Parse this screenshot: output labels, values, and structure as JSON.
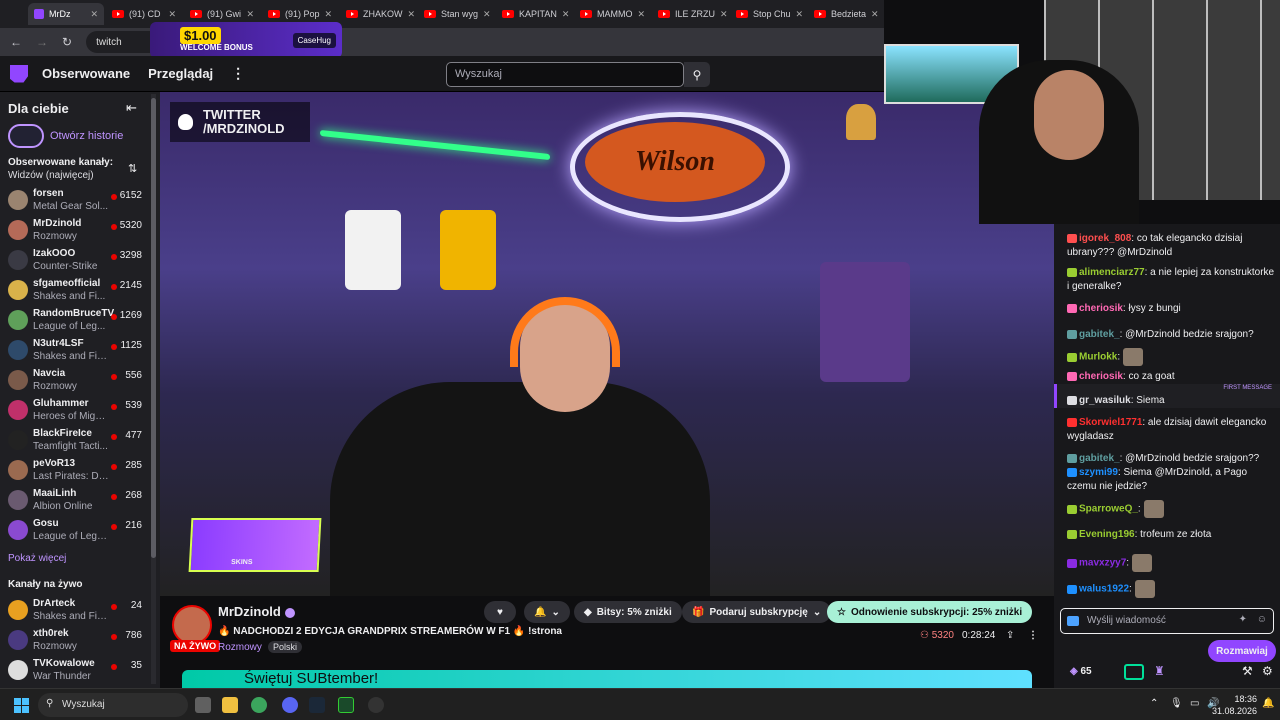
{
  "browser": {
    "tabs": [
      {
        "label": "MrDz",
        "kind": "twitch",
        "active": true
      },
      {
        "label": "(91) CD",
        "kind": "yt"
      },
      {
        "label": "(91) Gwi",
        "kind": "yt"
      },
      {
        "label": "(91) Pop",
        "kind": "yt"
      },
      {
        "label": "ZHAKOW",
        "kind": "yt"
      },
      {
        "label": "Stan wyg",
        "kind": "yt"
      },
      {
        "label": "KAPITAN",
        "kind": "yt"
      },
      {
        "label": "MAMMO",
        "kind": "yt"
      },
      {
        "label": "ILE ZRZU",
        "kind": "yt"
      },
      {
        "label": "Stop Chu",
        "kind": "yt"
      },
      {
        "label": "Bedzieta",
        "kind": "yt"
      }
    ],
    "url": "twitch",
    "ad": {
      "price": "$1.00",
      "text": "WELCOME BONUS",
      "brand": "CaseHug"
    }
  },
  "header": {
    "nav_following": "Obserwowane",
    "nav_browse": "Przeglądaj",
    "search_placeholder": "Wyszukaj"
  },
  "sidebar": {
    "title": "Dla ciebie",
    "history": "Otwórz historie",
    "followed_title": "Obserwowane kanały:",
    "followed_sort": "Widzów (najwięcej)",
    "followed": [
      {
        "name": "forsen",
        "game": "Metal Gear Sol...",
        "viewers": "6152",
        "color": "#9a8470"
      },
      {
        "name": "MrDzinold",
        "game": "Rozmowy",
        "viewers": "5320",
        "color": "#b46a58"
      },
      {
        "name": "IzakOOO",
        "game": "Counter-Strike",
        "viewers": "3298",
        "color": "#3a3a44"
      },
      {
        "name": "sfgameofficial",
        "game": "Shakes and Fi...",
        "viewers": "2145",
        "color": "#d9b24a"
      },
      {
        "name": "RandomBruceTV",
        "game": "League of Leg...",
        "viewers": "1269",
        "color": "#5fa05a"
      },
      {
        "name": "N3utr4LSF",
        "game": "Shakes and Fid...",
        "viewers": "1125",
        "color": "#2e4a6a"
      },
      {
        "name": "Navcia",
        "game": "Rozmowy",
        "viewers": "556",
        "color": "#7a5a4a"
      },
      {
        "name": "Gluhammer",
        "game": "Heroes of Migh...",
        "viewers": "539",
        "color": "#c0306a"
      },
      {
        "name": "BlackFireIce",
        "game": "Teamfight Tacti...",
        "viewers": "477",
        "color": "#222"
      },
      {
        "name": "peVoR13",
        "game": "Last Pirates: Di...",
        "viewers": "285",
        "color": "#9a6a50"
      },
      {
        "name": "MaaiLinh",
        "game": "Albion Online",
        "viewers": "268",
        "color": "#6a5a70"
      },
      {
        "name": "Gosu",
        "game": "League of Lege...",
        "viewers": "216",
        "color": "#8a4ad0"
      }
    ],
    "show_more": "Pokaż więcej",
    "live_title": "Kanały na żywo",
    "live": [
      {
        "name": "DrArteck",
        "game": "Shakes and Fid...",
        "viewers": "24",
        "color": "#e8a020"
      },
      {
        "name": "xth0rek",
        "game": "Rozmowy",
        "viewers": "786",
        "color": "#4a3a80"
      },
      {
        "name": "TVKowalowe",
        "game": "War Thunder",
        "viewers": "35",
        "color": "#ddd"
      }
    ]
  },
  "video": {
    "badge": "TWITTER /MRDZINOLD",
    "ball_brand": "Wilson",
    "overlay_brand": "SKINS"
  },
  "stream": {
    "streamer": "MrDzinold",
    "live_badge": "NA ŻYWO",
    "title": "🔥 NADCHODZI 2 EDYCJA GRANDPRIX STREAMERÓW W F1 🔥 !strona",
    "category": "Rozmowy",
    "tag": "Polski",
    "bits": "Bitsy: 5% zniżki",
    "gift": "Podaruj subskrypcję",
    "renew": "Odnowienie subskrypcji: 25% zniżki",
    "viewers": "5320",
    "uptime": "0:28:24",
    "banner": "Świętuj SUBtember!"
  },
  "chat": {
    "messages": [
      {
        "user": "igorek_808",
        "color": "#ff4f4f",
        "text": ": co tak elegancko dzisiaj ubrany??? @MrDzinold"
      },
      {
        "user": "alimenciarz77",
        "color": "#9acd32",
        "text": ": a nie lepiej za konstruktorke i generalke?"
      },
      {
        "user": "cheriosik",
        "color": "#ff69b4",
        "text": ": łysy z bungi"
      },
      {
        "user": "gabitek_",
        "color": "#5f9ea0",
        "text": ": @MrDzinold bedzie srajgon?"
      },
      {
        "user": "Murlokk",
        "color": "#9acd32",
        "text": ":"
      },
      {
        "user": "cheriosik",
        "color": "#ff69b4",
        "text": ": co za goat"
      },
      {
        "user": "gr_wasiluk",
        "color": "#dedee3",
        "text": ": Siema"
      },
      {
        "user": "Skorwiel1771",
        "color": "#ff3030",
        "text": ": ale dzisiaj dawit elegancko wygladasz"
      },
      {
        "user": "gabitek_",
        "color": "#5f9ea0",
        "text": ": @MrDzinold bedzie srajgon??"
      },
      {
        "user": "szymi99",
        "color": "#1e90ff",
        "text": ": Siema @MrDzinold, a Pago czemu nie jedzie?"
      },
      {
        "user": "SparroweQ_",
        "color": "#9acd32",
        "text": ":"
      },
      {
        "user": "Evening196",
        "color": "#9acd32",
        "text": ": trofeum ze złota"
      },
      {
        "user": "mavxzyy7",
        "color": "#8a2be2",
        "text": ":"
      },
      {
        "user": "walus1922",
        "color": "#1e90ff",
        "text": ":"
      }
    ],
    "first_message": "FIRST MESSAGE",
    "input_placeholder": "Wyślij wiadomość",
    "send": "Rozmawiaj",
    "points": "65"
  },
  "taskbar": {
    "search": "Wyszukaj",
    "time": "18:36",
    "date": "31.08.2026"
  }
}
